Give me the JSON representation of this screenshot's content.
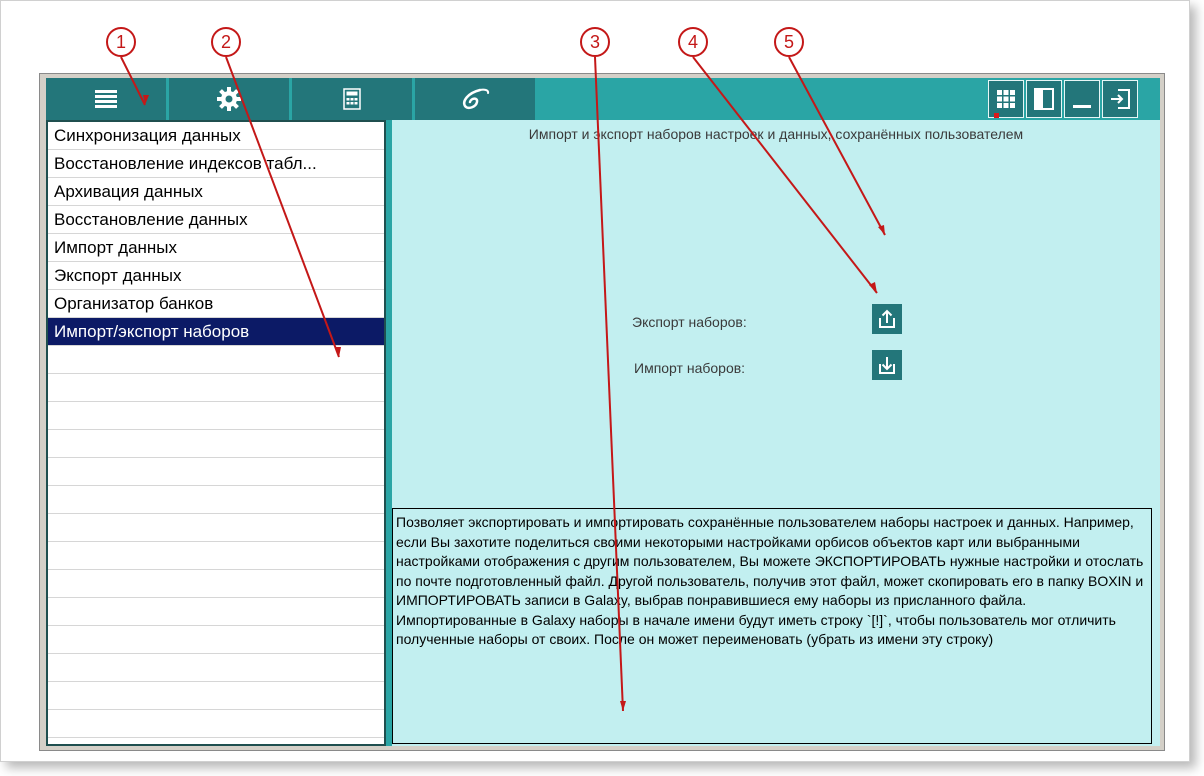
{
  "toolbar": {
    "icons": [
      "menu-icon",
      "gear-icon",
      "calculator-icon",
      "galaxy-logo-icon"
    ],
    "right_icons": [
      "grid-icon",
      "panel-layout-icon",
      "minimize-icon",
      "exit-icon"
    ]
  },
  "list": {
    "items": [
      "Синхронизация данных",
      "Восстановление индексов табл...",
      "Архивация данных",
      "Восстановление данных",
      "Импорт данных",
      "Экспорт данных",
      "Организатор банков",
      "Импорт/экспорт наборов"
    ],
    "selected_index": 7
  },
  "main": {
    "title": "Импорт и экспорт наборов настроек и данных, сохранённых пользователем",
    "export_label": "Экспорт наборов:",
    "import_label": "Импорт наборов:",
    "description": "Позволяет экспортировать и импортировать сохранённые пользователем наборы настроек и данных. Например, если Вы захотите поделиться своими некоторыми настройками орбисов объектов карт или выбранными настройками отображения с другим пользователем, Вы можете ЭКСПОРТИРОВАТЬ нужные настройки и отослать по почте подготовленный файл. Другой пользователь, получив этот файл, может скопировать его в папку BOXIN и ИМПОРТИРОВАТЬ записи в Galaxy, выбрав понравившиеся ему наборы из присланного файла. Импортированные в Galaxy наборы в начале имени будут иметь строку `[!]`, чтобы пользователь мог отличить полученные наборы от своих. После он может переименовать (убрать из имени эту строку)"
  },
  "callouts": [
    "1",
    "2",
    "3",
    "4",
    "5"
  ],
  "colors": {
    "toolbar_bg": "#2aa5a5",
    "button_bg": "#23767a",
    "panel_bg": "#c2eff0",
    "selected_bg": "#0c1a66",
    "callout_red": "#c41818"
  }
}
